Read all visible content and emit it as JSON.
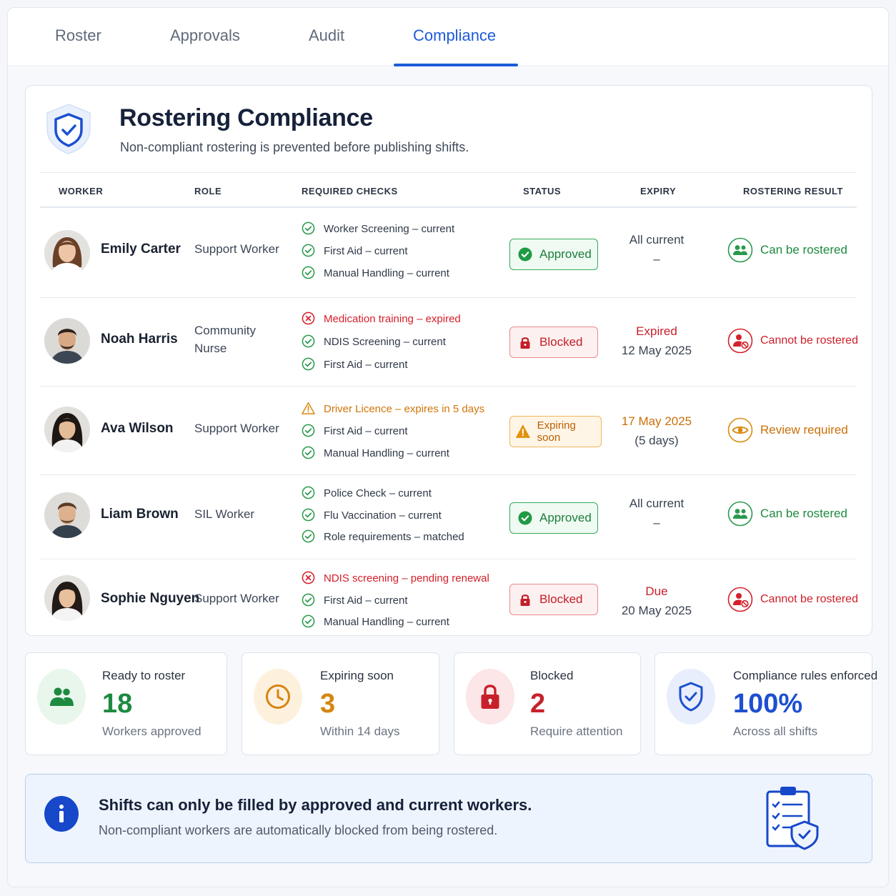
{
  "tabs": [
    {
      "label": "Roster",
      "active": false
    },
    {
      "label": "Approvals",
      "active": false
    },
    {
      "label": "Audit",
      "active": false
    },
    {
      "label": "Compliance",
      "active": true
    }
  ],
  "card": {
    "title": "Rostering Compliance",
    "subtitle": "Non-compliant rostering is prevented before publishing shifts.",
    "icon": "shield-check-icon"
  },
  "table": {
    "headers": {
      "worker": "WORKER",
      "role": "ROLE",
      "checks": "REQUIRED CHECKS",
      "status": "STATUS",
      "expiry": "EXPIRY",
      "result": "ROSTERING RESULT"
    },
    "rows": [
      {
        "name": "Emily Carter",
        "role": "Support Worker",
        "checks": [
          {
            "text": "Worker Screening – current",
            "state": "ok"
          },
          {
            "text": "First Aid – current",
            "state": "ok"
          },
          {
            "text": "Manual Handling – current",
            "state": "ok"
          }
        ],
        "status": "Approved",
        "expiry_line1": "All current",
        "expiry_line2": "–",
        "result": "Can be rostered"
      },
      {
        "name": "Noah Harris",
        "role": "Community Nurse",
        "checks": [
          {
            "text": "Medication training – expired",
            "state": "error"
          },
          {
            "text": "NDIS Screening – current",
            "state": "ok"
          },
          {
            "text": "First Aid – current",
            "state": "ok"
          }
        ],
        "status": "Blocked",
        "expiry_line1": "Expired",
        "expiry_line2": "12 May 2025",
        "result": "Cannot be rostered"
      },
      {
        "name": "Ava Wilson",
        "role": "Support Worker",
        "checks": [
          {
            "text": "Driver Licence – expires in 5 days",
            "state": "warning"
          },
          {
            "text": "First Aid – current",
            "state": "ok"
          },
          {
            "text": "Manual Handling – current",
            "state": "ok"
          }
        ],
        "status": "Expiring soon",
        "expiry_line1": "17 May 2025",
        "expiry_line2": "(5 days)",
        "result": "Review required"
      },
      {
        "name": "Liam Brown",
        "role": "SIL Worker",
        "checks": [
          {
            "text": "Police Check – current",
            "state": "ok"
          },
          {
            "text": "Flu Vaccination – current",
            "state": "ok"
          },
          {
            "text": "Role requirements – matched",
            "state": "ok"
          }
        ],
        "status": "Approved",
        "expiry_line1": "All current",
        "expiry_line2": "–",
        "result": "Can be rostered"
      },
      {
        "name": "Sophie Nguyen",
        "role": "Support Worker",
        "checks": [
          {
            "text": "NDIS screening – pending renewal",
            "state": "error"
          },
          {
            "text": "First Aid – current",
            "state": "ok"
          },
          {
            "text": "Manual Handling – current",
            "state": "ok"
          }
        ],
        "status": "Blocked",
        "expiry_line1": "Due",
        "expiry_line2": "20 May 2025",
        "result": "Cannot be rostered"
      }
    ]
  },
  "stats": [
    {
      "label": "Ready to roster",
      "value": "18",
      "sub": "Workers approved",
      "icon": "users-icon",
      "color": "#1e8a40"
    },
    {
      "label": "Expiring soon",
      "value": "3",
      "sub": "Within 14 days",
      "icon": "clock-icon",
      "color": "#d68510"
    },
    {
      "label": "Blocked",
      "value": "2",
      "sub": "Require attention",
      "icon": "lock-icon",
      "color": "#c8202a"
    },
    {
      "label": "Compliance rules enforced",
      "value": "100%",
      "sub": "Across all shifts",
      "icon": "shield-check-icon",
      "color": "#1d4fd0"
    }
  ],
  "banner": {
    "title": "Shifts can only be filled by approved and current workers.",
    "text": "Non-compliant workers are automatically blocked from being rostered.",
    "icon": "info-icon",
    "illustration": "clipboard-shield-icon"
  },
  "colors": {
    "accent": "#1d5bd8",
    "approved": "#1e8a40",
    "blocked": "#c8202a",
    "warning": "#d0760b"
  }
}
